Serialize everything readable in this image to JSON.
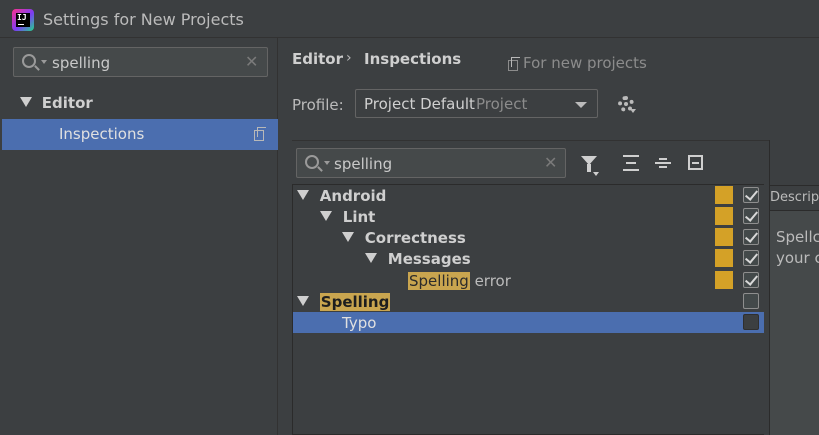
{
  "window": {
    "title": "Settings for New Projects"
  },
  "left": {
    "search": {
      "value": "spelling"
    },
    "tree": [
      {
        "label": "Editor"
      },
      {
        "label": "Inspections"
      }
    ]
  },
  "breadcrumb": {
    "parent": "Editor",
    "sep": "›",
    "current": "Inspections",
    "scope": "For new projects"
  },
  "profile": {
    "label": "Profile:",
    "value": "Project Default",
    "scope": "Project"
  },
  "inspections": {
    "search": {
      "value": "spelling"
    },
    "rows": [
      {
        "label": "Android",
        "checked": true,
        "severity": "#d4a127"
      },
      {
        "label": "Lint",
        "checked": true,
        "severity": "#d4a127"
      },
      {
        "label": "Correctness",
        "checked": true,
        "severity": "#d4a127"
      },
      {
        "label": "Messages",
        "checked": true,
        "severity": "#d4a127"
      },
      {
        "label_highlight": "Spelling",
        "label_rest": " error",
        "checked": true,
        "severity": "#d4a127"
      },
      {
        "label": "Spelling",
        "checked": false
      },
      {
        "label": "Typo",
        "checked": false,
        "selected": true
      }
    ]
  },
  "description": {
    "header": "Description",
    "line1": "Spellchecks",
    "line2": "your code"
  },
  "colors": {
    "selection": "#4b6eaf",
    "severity_warning": "#d4a127",
    "search_highlight": "#c9a54f"
  }
}
